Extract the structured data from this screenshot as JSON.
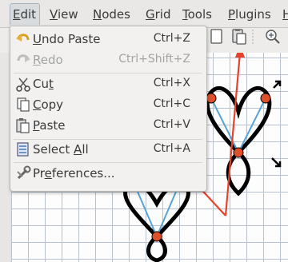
{
  "menubar": {
    "items": [
      {
        "label": "Edit",
        "underline": "E",
        "rest": "dit"
      },
      {
        "label": "View",
        "underline": "V",
        "rest": "iew"
      },
      {
        "label": "Nodes",
        "underline": "N",
        "rest": "odes"
      },
      {
        "label": "Grid",
        "underline": "G",
        "rest": "rid"
      },
      {
        "label": "Tools",
        "underline": "T",
        "rest": "ools"
      },
      {
        "label": "Plugins",
        "underline": "P",
        "rest": "lugins"
      },
      {
        "label": "H",
        "underline": "H",
        "rest": ""
      }
    ]
  },
  "edit_menu": {
    "undo": {
      "label": "Undo Paste",
      "u": "U",
      "rest": "ndo Paste",
      "accel": "Ctrl+Z",
      "icon": "undo-icon"
    },
    "redo": {
      "label": "Redo",
      "u": "R",
      "rest": "edo",
      "accel": "Ctrl+Shift+Z",
      "icon": "redo-icon"
    },
    "cut": {
      "label": "Cut",
      "pre": "Cu",
      "u": "t",
      "accel": "Ctrl+X",
      "icon": "scissors-icon"
    },
    "copy": {
      "label": "Copy",
      "u": "C",
      "rest": "opy",
      "accel": "Ctrl+C",
      "icon": "copy-icon"
    },
    "paste": {
      "label": "Paste",
      "u": "P",
      "rest": "aste",
      "accel": "Ctrl+V",
      "icon": "paste-icon"
    },
    "select_all": {
      "label": "Select All",
      "pre": "Select ",
      "u": "A",
      "rest": "ll",
      "accel": "Ctrl+A",
      "icon": "select-all-icon"
    },
    "preferences": {
      "label": "Preferences...",
      "pre": "Pr",
      "u": "e",
      "rest": "ferences...",
      "accel": "",
      "icon": "preferences-icon"
    }
  },
  "colors": {
    "arrow": "#e8412c",
    "node": "#e0502a",
    "handle_line": "#5aa3d6",
    "grid": "#b9c2cc"
  }
}
